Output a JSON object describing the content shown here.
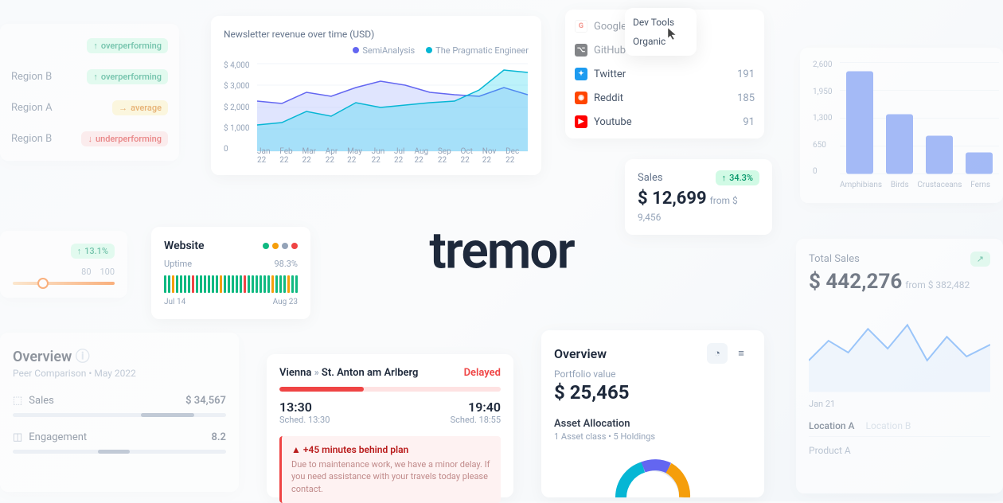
{
  "brand": "tremor",
  "performance": {
    "rows": [
      {
        "label": "",
        "status": "overperforming",
        "tone": "green",
        "dir": "up"
      },
      {
        "label": "Region B",
        "status": "overperforming",
        "tone": "green",
        "dir": "up"
      },
      {
        "label": "Region A",
        "status": "average",
        "tone": "amber",
        "dir": "right"
      },
      {
        "label": "Region B",
        "status": "underperforming",
        "tone": "red",
        "dir": "down"
      }
    ]
  },
  "newsletter": {
    "title": "Newsletter revenue over time (USD)",
    "legend": [
      "SemiAnalysis",
      "The Pragmatic Engineer"
    ],
    "y_ticks": [
      "$ 4,000",
      "$ 3,000",
      "$ 2,000",
      "$ 1,000",
      "0"
    ],
    "x_ticks": [
      "Jan 22",
      "Feb 22",
      "Mar 22",
      "Apr 22",
      "May 22",
      "Jun 22",
      "Jul 22",
      "Aug 22",
      "Sep 22",
      "Oct 22",
      "Nov 22",
      "Dec 22"
    ]
  },
  "sources": {
    "dropdown": [
      "Dev Tools",
      "Organic"
    ],
    "items": [
      {
        "icon": "G",
        "color": "#ea4335",
        "name": "Google",
        "count": ""
      },
      {
        "icon": "gh",
        "color": "#1f2328",
        "name": "GitHub",
        "count": ""
      },
      {
        "icon": "tw",
        "color": "#1d9bf0",
        "name": "Twitter",
        "count": "191"
      },
      {
        "icon": "rd",
        "color": "#ff4500",
        "name": "Reddit",
        "count": "185"
      },
      {
        "icon": "yt",
        "color": "#ff0000",
        "name": "Youtube",
        "count": "91"
      }
    ]
  },
  "species": {
    "y_ticks": [
      "2,600",
      "1,950",
      "1,300",
      "650",
      "0"
    ],
    "bars": [
      {
        "label": "Amphibians",
        "v": 2400
      },
      {
        "label": "Birds",
        "v": 1400
      },
      {
        "label": "Crustaceans",
        "v": 900
      },
      {
        "label": "Ferns",
        "v": 500
      }
    ]
  },
  "slider": {
    "badge": "13.1%",
    "marks": [
      "80",
      "100"
    ]
  },
  "website": {
    "title": "Website",
    "uptime_label": "Uptime",
    "uptime_value": "98.3%",
    "start": "Jul 14",
    "end": "Aug 23"
  },
  "sales_kpi": {
    "label": "Sales",
    "value": "$ 12,699",
    "from": "from $ 9,456",
    "delta": "34.3%"
  },
  "total_sales": {
    "label": "Total Sales",
    "value": "$ 442,276",
    "from": "from $ 382,482",
    "xtick": "Jan 21",
    "tabs": [
      "Location A",
      "Location B"
    ],
    "row": "Product A"
  },
  "overview": {
    "title": "Overview",
    "subtitle": "Peer Comparison • May 2022",
    "metrics": [
      {
        "name": "Sales",
        "value": "$ 34,567"
      },
      {
        "name": "Engagement",
        "value": "8.2"
      }
    ]
  },
  "travel": {
    "from": "Vienna",
    "to": "St. Anton am Arlberg",
    "status": "Delayed",
    "dep_time": "13:30",
    "dep_sched": "Sched. 13:30",
    "arr_time": "19:40",
    "arr_sched": "Sched. 18:55",
    "alert_title": "+45 minutes behind plan",
    "alert_msg": "Due to maintenance work, we have a minor delay. If you need assistance with your travels today please contact."
  },
  "portfolio": {
    "title": "Overview",
    "sub": "Portfolio value",
    "value": "$ 25,465",
    "alloc_title": "Asset Allocation",
    "alloc_sub": "1 Asset class • 5 Holdings"
  },
  "chart_data": [
    {
      "type": "area",
      "title": "Newsletter revenue over time (USD)",
      "x": [
        "Jan 22",
        "Feb 22",
        "Mar 22",
        "Apr 22",
        "May 22",
        "Jun 22",
        "Jul 22",
        "Aug 22",
        "Sep 22",
        "Oct 22",
        "Nov 22",
        "Dec 22"
      ],
      "series": [
        {
          "name": "SemiAnalysis",
          "values": [
            2300,
            2200,
            2700,
            2500,
            2900,
            3200,
            3000,
            2700,
            2600,
            2500,
            2900,
            2600
          ]
        },
        {
          "name": "The Pragmatic Engineer",
          "values": [
            1200,
            1300,
            1800,
            1600,
            2200,
            2000,
            2100,
            2200,
            2300,
            2800,
            3700,
            3600
          ]
        }
      ],
      "ylim": [
        0,
        4000
      ]
    },
    {
      "type": "bar",
      "categories": [
        "Amphibians",
        "Birds",
        "Crustaceans",
        "Ferns"
      ],
      "values": [
        2400,
        1400,
        900,
        500
      ],
      "ylim": [
        0,
        2600
      ]
    }
  ]
}
